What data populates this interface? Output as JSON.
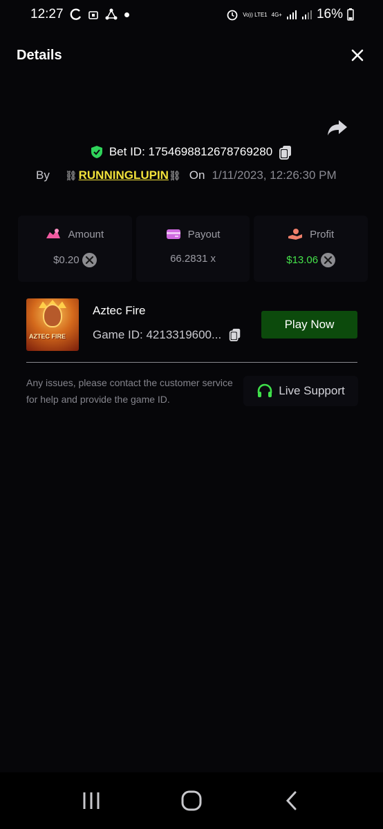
{
  "status_bar": {
    "time": "12:27",
    "lte_label": "Vo)) LTE1",
    "net_label": "4G+",
    "battery": "16%"
  },
  "header": {
    "title": "Details"
  },
  "bet": {
    "bet_id": "Bet ID: 1754698812678769280",
    "by_label": "By",
    "chain_left": "⛓",
    "username": "RUNNINGLUPIN",
    "chain_right": "⛓",
    "on_label": "On",
    "date": "1/11/2023, 12:26:30 PM"
  },
  "stats": {
    "amount_label": "Amount",
    "amount_value": "$0.20",
    "payout_label": "Payout",
    "payout_value": "66.2831 x",
    "profit_label": "Profit",
    "profit_value": "$13.06"
  },
  "game": {
    "thumb_text": "AZTEC FIRE",
    "name": "Aztec Fire",
    "game_id": "Game ID: 4213319600...",
    "play_label": "Play Now"
  },
  "support": {
    "help_text": "Any issues, please contact the customer service for help and provide the game ID.",
    "live_support_label": "Live Support"
  },
  "colors": {
    "background": "#060609",
    "accent_green": "#45e24a",
    "play_button": "#0c4a0c",
    "username": "#f2e23a"
  }
}
